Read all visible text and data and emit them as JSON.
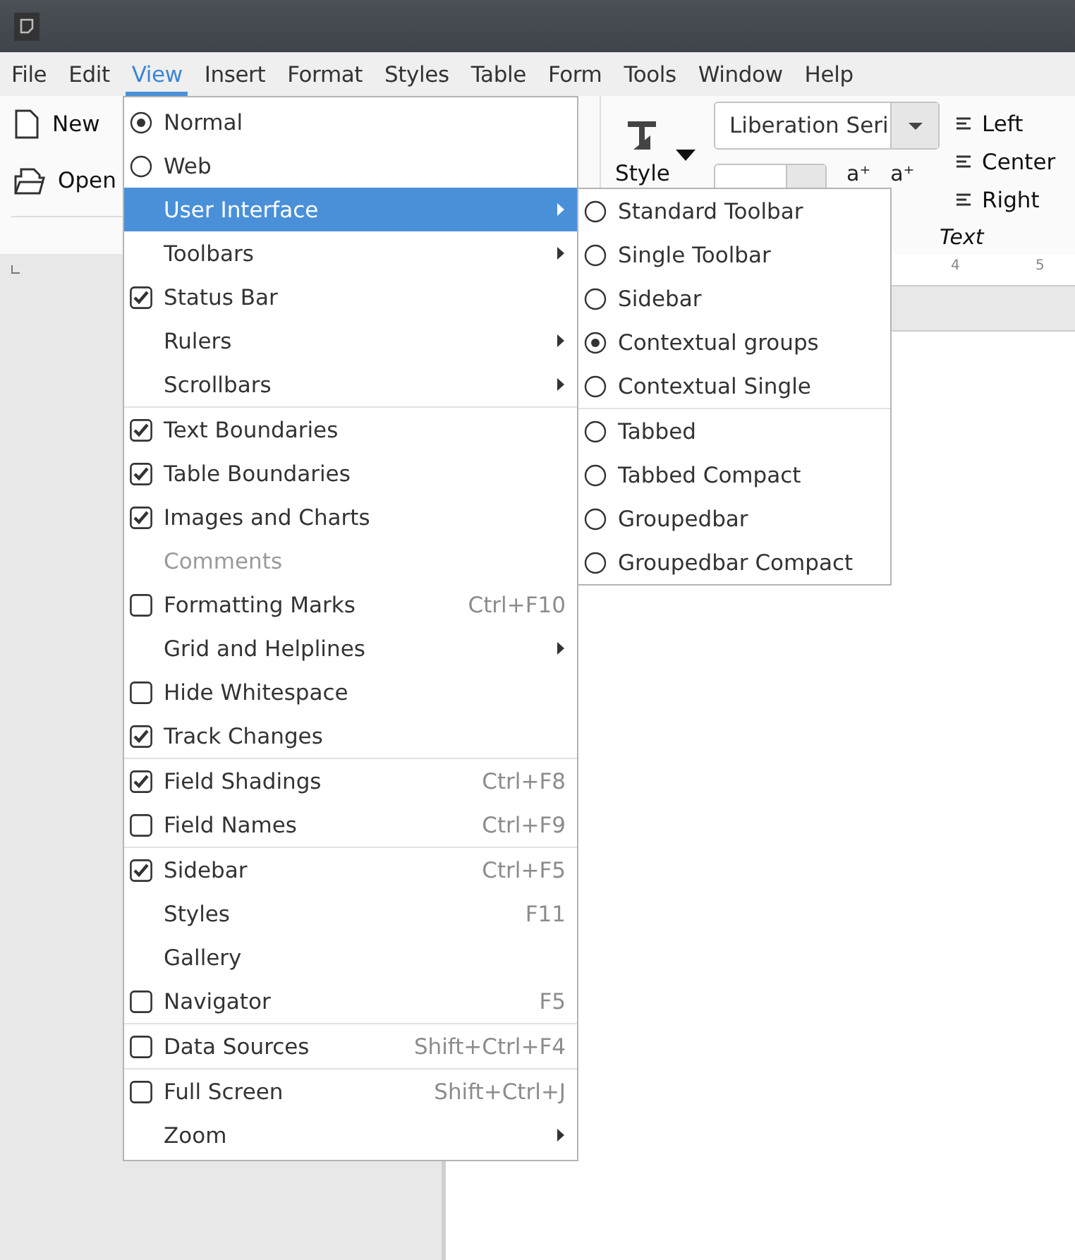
{
  "menubar": [
    {
      "label": "File",
      "selected": false
    },
    {
      "label": "Edit",
      "selected": false
    },
    {
      "label": "View",
      "selected": true
    },
    {
      "label": "Insert",
      "selected": false
    },
    {
      "label": "Format",
      "selected": false
    },
    {
      "label": "Styles",
      "selected": false
    },
    {
      "label": "Table",
      "selected": false
    },
    {
      "label": "Form",
      "selected": false
    },
    {
      "label": "Tools",
      "selected": false
    },
    {
      "label": "Window",
      "selected": false
    },
    {
      "label": "Help",
      "selected": false
    }
  ],
  "toolbar": {
    "file_buttons": [
      {
        "kind": "new",
        "label": "New"
      },
      {
        "kind": "open",
        "label": "Open"
      }
    ],
    "style_button": {
      "label": "Style"
    },
    "font_name": "Liberation Seri",
    "size_buttons": [
      "a⁺",
      "a⁺"
    ],
    "align_buttons": [
      "Left",
      "Center",
      "Right"
    ],
    "group_label": "Text",
    "ruler_numbers": [
      "4",
      "5"
    ]
  },
  "view_menu": {
    "groups": [
      [
        {
          "kind": "radio",
          "label": "Normal",
          "checked": true,
          "selected": false,
          "disabled": false
        },
        {
          "kind": "radio",
          "label": "Web",
          "checked": false,
          "selected": false,
          "disabled": false
        },
        {
          "kind": "plain",
          "label": "User Interface",
          "submenu": true,
          "selected": true,
          "disabled": false
        },
        {
          "kind": "plain",
          "label": "Toolbars",
          "submenu": true,
          "selected": false,
          "disabled": false
        },
        {
          "kind": "check",
          "label": "Status Bar",
          "checked": true,
          "selected": false,
          "disabled": false
        },
        {
          "kind": "plain",
          "label": "Rulers",
          "submenu": true,
          "selected": false,
          "disabled": false
        },
        {
          "kind": "plain",
          "label": "Scrollbars",
          "submenu": true,
          "selected": false,
          "disabled": false
        }
      ],
      [
        {
          "kind": "check",
          "label": "Text Boundaries",
          "checked": true,
          "selected": false,
          "disabled": false
        },
        {
          "kind": "check",
          "label": "Table Boundaries",
          "checked": true,
          "selected": false,
          "disabled": false
        },
        {
          "kind": "check",
          "label": "Images and Charts",
          "checked": true,
          "selected": false,
          "disabled": false
        },
        {
          "kind": "plain",
          "label": "Comments",
          "selected": false,
          "disabled": true
        },
        {
          "kind": "check",
          "label": "Formatting Marks",
          "checked": false,
          "shortcut": "Ctrl+F10",
          "selected": false,
          "disabled": false
        },
        {
          "kind": "plain",
          "label": "Grid and Helplines",
          "submenu": true,
          "selected": false,
          "disabled": false
        },
        {
          "kind": "check",
          "label": "Hide Whitespace",
          "checked": false,
          "selected": false,
          "disabled": false
        },
        {
          "kind": "check",
          "label": "Track Changes",
          "checked": true,
          "selected": false,
          "disabled": false
        }
      ],
      [
        {
          "kind": "check",
          "label": "Field Shadings",
          "checked": true,
          "shortcut": "Ctrl+F8",
          "selected": false,
          "disabled": false
        },
        {
          "kind": "check",
          "label": "Field Names",
          "checked": false,
          "shortcut": "Ctrl+F9",
          "selected": false,
          "disabled": false
        }
      ],
      [
        {
          "kind": "check",
          "label": "Sidebar",
          "checked": true,
          "shortcut": "Ctrl+F5",
          "selected": false,
          "disabled": false
        },
        {
          "kind": "plain",
          "label": "Styles",
          "shortcut": "F11",
          "selected": false,
          "disabled": false
        },
        {
          "kind": "plain",
          "label": "Gallery",
          "selected": false,
          "disabled": false
        },
        {
          "kind": "check",
          "label": "Navigator",
          "checked": false,
          "shortcut": "F5",
          "selected": false,
          "disabled": false
        }
      ],
      [
        {
          "kind": "check",
          "label": "Data Sources",
          "checked": false,
          "shortcut": "Shift+Ctrl+F4",
          "selected": false,
          "disabled": false
        }
      ],
      [
        {
          "kind": "check",
          "label": "Full Screen",
          "checked": false,
          "shortcut": "Shift+Ctrl+J",
          "selected": false,
          "disabled": false
        },
        {
          "kind": "plain",
          "label": "Zoom",
          "submenu": true,
          "selected": false,
          "disabled": false
        }
      ]
    ]
  },
  "user_interface_submenu": {
    "groups": [
      [
        {
          "label": "Standard Toolbar",
          "checked": false
        },
        {
          "label": "Single Toolbar",
          "checked": false
        },
        {
          "label": "Sidebar",
          "checked": false
        },
        {
          "label": "Contextual groups",
          "checked": true
        },
        {
          "label": "Contextual Single",
          "checked": false
        }
      ],
      [
        {
          "label": "Tabbed",
          "checked": false
        },
        {
          "label": "Tabbed Compact",
          "checked": false
        },
        {
          "label": "Groupedbar",
          "checked": false
        },
        {
          "label": "Groupedbar Compact",
          "checked": false
        }
      ]
    ]
  }
}
